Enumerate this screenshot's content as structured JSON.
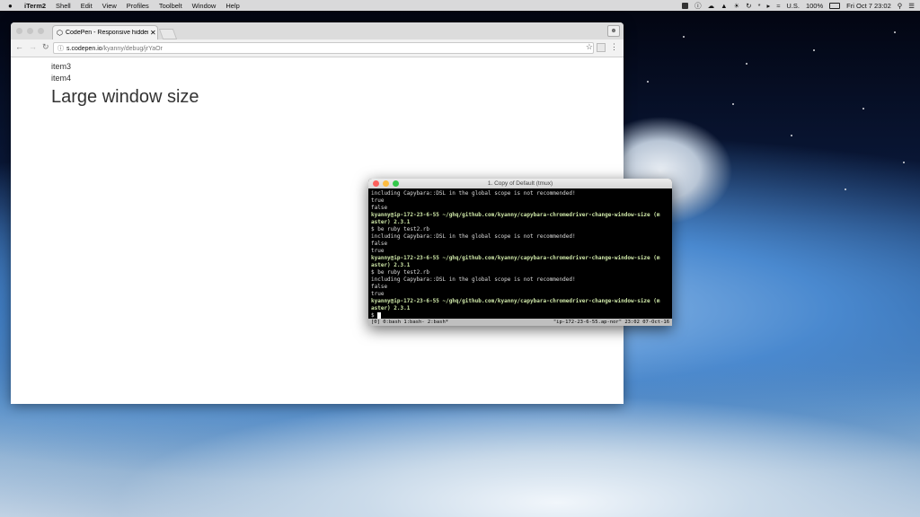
{
  "menubar": {
    "apple": "",
    "app_name": "iTerm2",
    "items": [
      "Shell",
      "Edit",
      "View",
      "Profiles",
      "Toolbelt",
      "Window",
      "Help"
    ],
    "input_source": "U.S.",
    "battery": "100%",
    "datetime": "Fri Oct 7  23:02"
  },
  "browser": {
    "tab_title": "CodePen - Responsive hidden",
    "url_host": "s.codepen.io",
    "url_path": "/kyanny/debug/jrYaOr",
    "items": [
      "item3",
      "item4"
    ],
    "heading": "Large window size"
  },
  "terminal": {
    "title": "1. Copy of Default (tmux)",
    "lines": [
      {
        "text": "including Capybara::DSL in the global scope is not recommended!",
        "prompt": false
      },
      {
        "text": "true",
        "prompt": false
      },
      {
        "text": "false",
        "prompt": false
      },
      {
        "text": "kyanny@ip-172-23-6-55 ~/ghq/github.com/kyanny/capybara-chromedriver-change-window-size (m",
        "prompt": true
      },
      {
        "text": "aster) 2.3.1",
        "prompt": true
      },
      {
        "text": "$ be ruby test2.rb",
        "prompt": false
      },
      {
        "text": "including Capybara::DSL in the global scope is not recommended!",
        "prompt": false
      },
      {
        "text": "false",
        "prompt": false
      },
      {
        "text": "true",
        "prompt": false
      },
      {
        "text": "kyanny@ip-172-23-6-55 ~/ghq/github.com/kyanny/capybara-chromedriver-change-window-size (m",
        "prompt": true
      },
      {
        "text": "aster) 2.3.1",
        "prompt": true
      },
      {
        "text": "$ be ruby test2.rb",
        "prompt": false
      },
      {
        "text": "including Capybara::DSL in the global scope is not recommended!",
        "prompt": false
      },
      {
        "text": "false",
        "prompt": false
      },
      {
        "text": "true",
        "prompt": false
      },
      {
        "text": "kyanny@ip-172-23-6-55 ~/ghq/github.com/kyanny/capybara-chromedriver-change-window-size (m",
        "prompt": true
      },
      {
        "text": "aster) 2.3.1",
        "prompt": true
      }
    ],
    "current_prompt": "$",
    "status_left": "[0] 0:bash  1:bash- 2:bash*",
    "status_right": "\"ip-172-23-6-55.ap-nor\" 23:02 07-Oct-16"
  },
  "colors": {
    "close": "#fc605c",
    "minimize": "#fdbc40",
    "zoom": "#34c84a",
    "prompt": "#cfe8a8"
  }
}
